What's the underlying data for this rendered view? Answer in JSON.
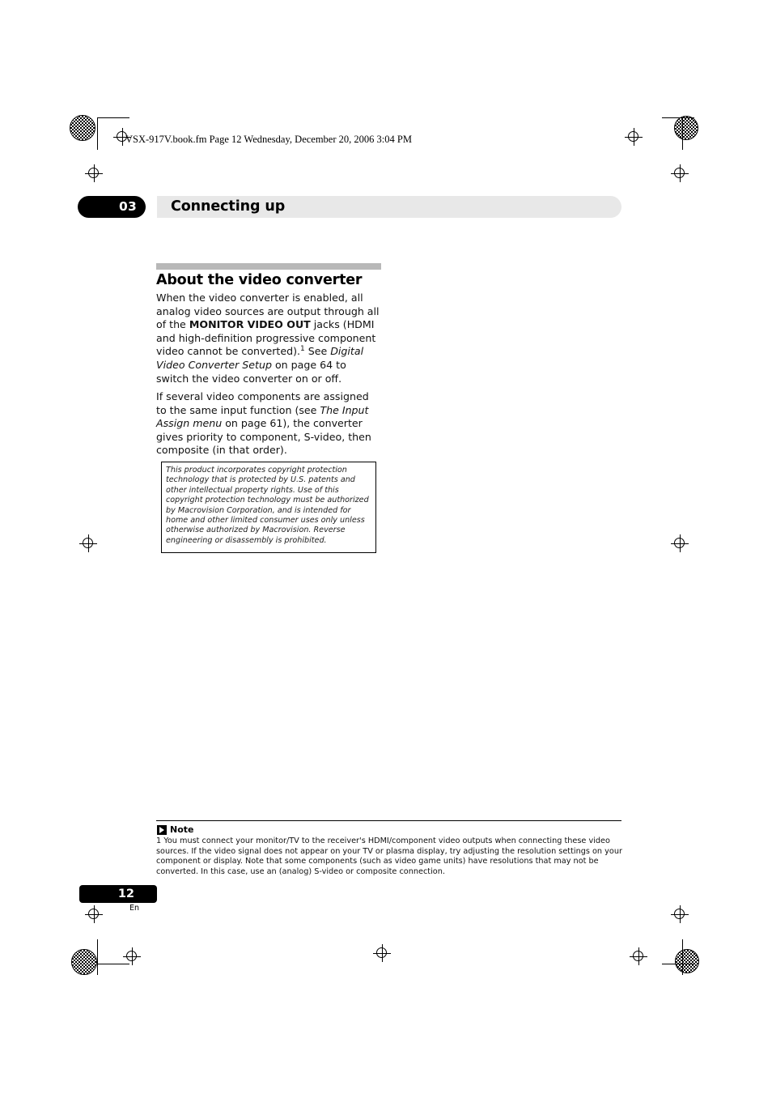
{
  "header": {
    "file_line": "VSX-917V.book.fm  Page 12  Wednesday, December 20, 2006  3:04 PM"
  },
  "chapter": {
    "number": "03",
    "title": "Connecting up"
  },
  "section": {
    "title": "About the video converter",
    "paragraph_1_html": "When the video converter is enabled, all analog video sources are output through all of the <b>MONITOR VIDEO OUT</b> jacks (HDMI and high-definition progressive component video cannot be converted).<sup>1</sup> See <i>Digital Video Converter Setup</i> on page 64 to switch the video converter on or off.",
    "paragraph_2_html": "If several video components are assigned to the same input function (see <i>The Input Assign menu</i> on page 61), the converter gives priority to component, S-video, then composite (in that order)."
  },
  "macrovision": {
    "text": "This product incorporates copyright protection technology that is protected by U.S. patents and other intellectual property rights. Use of this copyright protection technology must be authorized by Macrovision Corporation, and is intended for home and other limited consumer uses only unless otherwise authorized by Macrovision. Reverse engineering or disassembly is prohibited."
  },
  "note": {
    "label": "Note",
    "body": "1 You must connect your monitor/TV to the receiver's HDMI/component video outputs when connecting these video sources. If the video signal does not appear on your TV or plasma display, try adjusting the resolution settings on your component or display. Note that some components (such as video game units) have resolutions that may not be converted. In this case, use an (analog) S-video or composite connection."
  },
  "footer": {
    "page_number": "12",
    "language_code": "En"
  }
}
